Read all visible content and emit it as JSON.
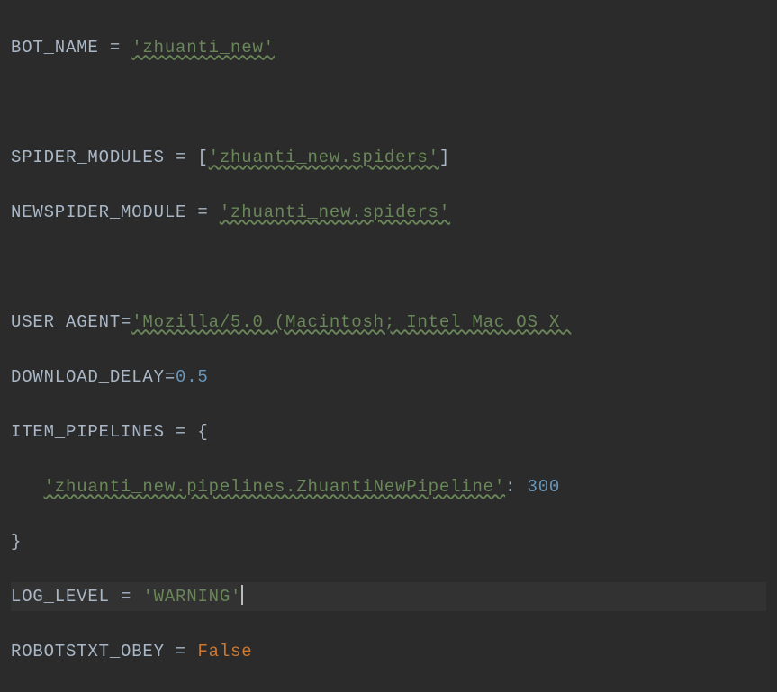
{
  "code": {
    "l1_var": "BOT_NAME",
    "l1_eq": " = ",
    "l1_val": "'zhuanti_new'",
    "l2_var": "SPIDER_MODULES",
    "l2_eq": " = [",
    "l2_val": "'zhuanti_new.spiders'",
    "l2_close": "]",
    "l3_var": "NEWSPIDER_MODULE",
    "l3_eq": " = ",
    "l3_val": "'zhuanti_new.spiders'",
    "l4_var": "USER_AGENT",
    "l4_eq": "=",
    "l4_val": "'Mozilla/5.0 (Macintosh; Intel Mac OS X ",
    "l5_var": "DOWNLOAD_DELAY",
    "l5_eq": "=",
    "l5_val": "0.5",
    "l6_var": "ITEM_PIPELINES",
    "l6_eq": " = {",
    "l7_indent": "   ",
    "l7_val": "'zhuanti_new.pipelines.ZhuantiNewPipeline'",
    "l7_colon": ": ",
    "l7_num": "300",
    "l8_close": "}",
    "l9_var": "LOG_LEVEL",
    "l9_eq": " = ",
    "l9_val": "'WARNING'",
    "l10_var": "ROBOTSTXT_OBEY",
    "l10_eq": " = ",
    "l10_val": "False"
  }
}
